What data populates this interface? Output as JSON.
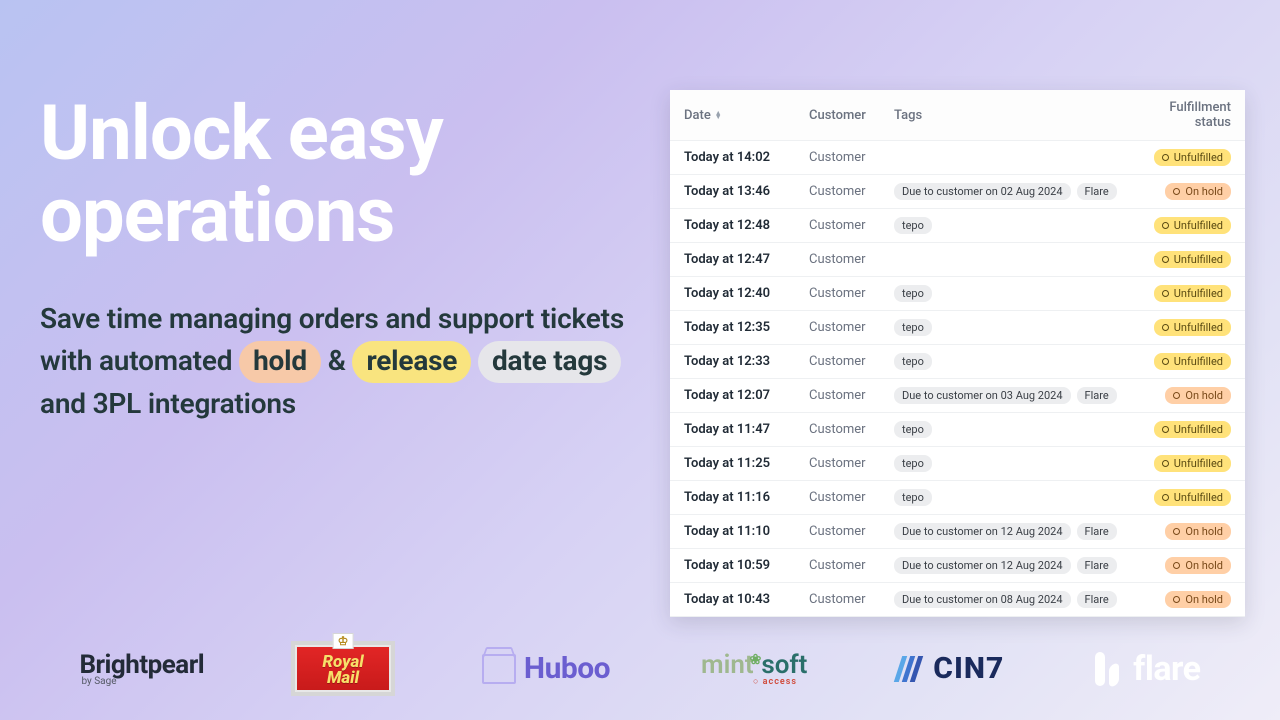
{
  "headline_l1": "Unlock easy",
  "headline_l2": "operations",
  "sub_a": "Save time managing orders and support tickets with automated ",
  "pill_hold": "hold",
  "sub_amp": " & ",
  "pill_release": "release",
  "pill_date": "date tags",
  "sub_b": " and 3PL integrations",
  "columns": {
    "date": "Date",
    "customer": "Customer",
    "tags": "Tags",
    "status": "Fulfillment status"
  },
  "customer_label": "Customer",
  "status_labels": {
    "unfulfilled": "Unfulfilled",
    "onhold": "On hold"
  },
  "rows": [
    {
      "date": "Today at 14:02",
      "tags": [],
      "status": "unfulfilled"
    },
    {
      "date": "Today at 13:46",
      "tags": [
        "Due to customer on 02 Aug 2024",
        "Flare"
      ],
      "status": "onhold"
    },
    {
      "date": "Today at 12:48",
      "tags": [
        "tepo"
      ],
      "status": "unfulfilled"
    },
    {
      "date": "Today at 12:47",
      "tags": [],
      "status": "unfulfilled"
    },
    {
      "date": "Today at 12:40",
      "tags": [
        "tepo"
      ],
      "status": "unfulfilled"
    },
    {
      "date": "Today at 12:35",
      "tags": [
        "tepo"
      ],
      "status": "unfulfilled"
    },
    {
      "date": "Today at 12:33",
      "tags": [
        "tepo"
      ],
      "status": "unfulfilled"
    },
    {
      "date": "Today at 12:07",
      "tags": [
        "Due to customer on 03 Aug 2024",
        "Flare"
      ],
      "status": "onhold"
    },
    {
      "date": "Today at 11:47",
      "tags": [
        "tepo"
      ],
      "status": "unfulfilled"
    },
    {
      "date": "Today at 11:25",
      "tags": [
        "tepo"
      ],
      "status": "unfulfilled"
    },
    {
      "date": "Today at 11:16",
      "tags": [
        "tepo"
      ],
      "status": "unfulfilled"
    },
    {
      "date": "Today at 11:10",
      "tags": [
        "Due to customer on 12 Aug 2024",
        "Flare"
      ],
      "status": "onhold"
    },
    {
      "date": "Today at 10:59",
      "tags": [
        "Due to customer on 12 Aug 2024",
        "Flare"
      ],
      "status": "onhold"
    },
    {
      "date": "Today at 10:43",
      "tags": [
        "Due to customer on 08 Aug 2024",
        "Flare"
      ],
      "status": "onhold"
    }
  ],
  "logos": {
    "brightpearl": "Brightpearl",
    "brightpearl_sub": "by Sage",
    "royalmail_l1": "Royal",
    "royalmail_l2": "Mail",
    "huboo": "Huboo",
    "mint": "mint",
    "soft": "soft",
    "mint_acc": "○ access",
    "cin7": "CIN7",
    "flare": "flare"
  }
}
